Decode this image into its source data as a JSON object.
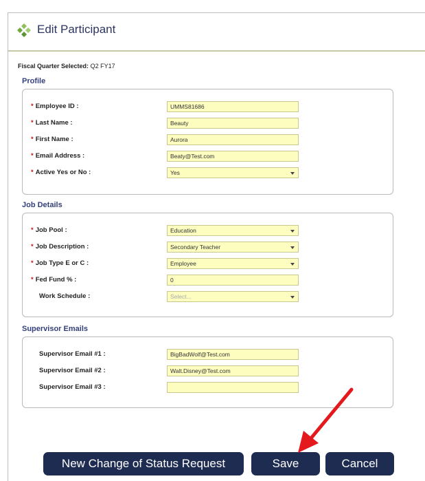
{
  "header": {
    "title": "Edit Participant"
  },
  "fiscal_quarter": {
    "label": "Fiscal Quarter Selected:",
    "value": "Q2 FY17"
  },
  "profile": {
    "title": "Profile",
    "employee_id": {
      "label": "Employee ID :",
      "value": "UMMS81686"
    },
    "last_name": {
      "label": "Last Name :",
      "value": "Beauty"
    },
    "first_name": {
      "label": "First Name :",
      "value": "Aurora"
    },
    "email": {
      "label": "Email Address :",
      "value": "Beaty@Test.com"
    },
    "active": {
      "label": "Active Yes or No :",
      "value": "Yes"
    }
  },
  "job": {
    "title": "Job Details",
    "pool": {
      "label": "Job Pool :",
      "value": "Education"
    },
    "description": {
      "label": "Job Description :",
      "value": "Secondary Teacher"
    },
    "type": {
      "label": "Job Type E or C :",
      "value": "Employee"
    },
    "fed_fund": {
      "label": "Fed Fund % :",
      "value": "0"
    },
    "schedule": {
      "label": "Work Schedule :",
      "placeholder": "Select..."
    }
  },
  "supervisor": {
    "title": "Supervisor Emails",
    "email1": {
      "label": "Supervisor Email #1 :",
      "value": "BigBadWolf@Test.com"
    },
    "email2": {
      "label": "Supervisor Email #2 :",
      "value": "Walt.Disney@Test.com"
    },
    "email3": {
      "label": "Supervisor Email #3 :",
      "value": ""
    }
  },
  "buttons": {
    "new_request": "New Change of Status Request",
    "save": "Save",
    "cancel": "Cancel"
  },
  "required_marker": "*",
  "colors": {
    "field_bg": "#fdfdc0",
    "section_title": "#34407b",
    "button_bg": "#1f2c52",
    "required": "#c0161b",
    "annotation_arrow": "#e3191e"
  },
  "icons": {
    "logo": "green-diamond-cluster-icon",
    "annotation": "red-arrow-icon"
  }
}
